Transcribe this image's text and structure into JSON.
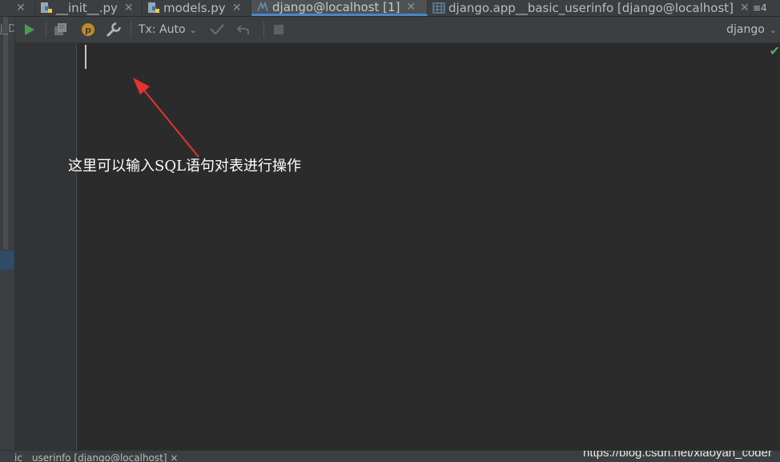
{
  "tabs": [
    {
      "label": "",
      "icon": "truncated-tab",
      "close": "✕",
      "active": false
    },
    {
      "label": "__init__.py",
      "icon": "python-file-icon",
      "close": "✕",
      "active": false
    },
    {
      "label": "models.py",
      "icon": "python-file-icon",
      "close": "✕",
      "active": false
    },
    {
      "label": "django@localhost [1]",
      "icon": "console-icon",
      "close": "✕",
      "active": true
    },
    {
      "label": "django.app__basic_userinfo [django@localhost]",
      "icon": "table-icon",
      "close": "✕",
      "active": false
    },
    {
      "label": "≡4",
      "icon": "tab-list-icon",
      "active": false
    }
  ],
  "left_strip": {
    "fragment": "j_D"
  },
  "toolbar": {
    "tx_label": "Tx: Auto",
    "dropdown_glyph": "⌄",
    "schema": "django",
    "icons": [
      "run-icon",
      "history-icon",
      "p-icon",
      "wrench-icon",
      "commit-icon",
      "rollback-icon",
      "stop-icon"
    ],
    "run_color": "#499c54",
    "p_color": "#c08a2a"
  },
  "editor": {
    "annotation": "这里可以输入SQL语句对表进行操作",
    "annotation_color": "#ffffff",
    "arrow_color": "#e8322f",
    "check": "✔",
    "check_color": "#59a869"
  },
  "bottom": {
    "tab_label": "__ic__userinfo [django@localhost] ×",
    "watermark": "https://blog.csdn.net/xiaoyan_coder"
  }
}
